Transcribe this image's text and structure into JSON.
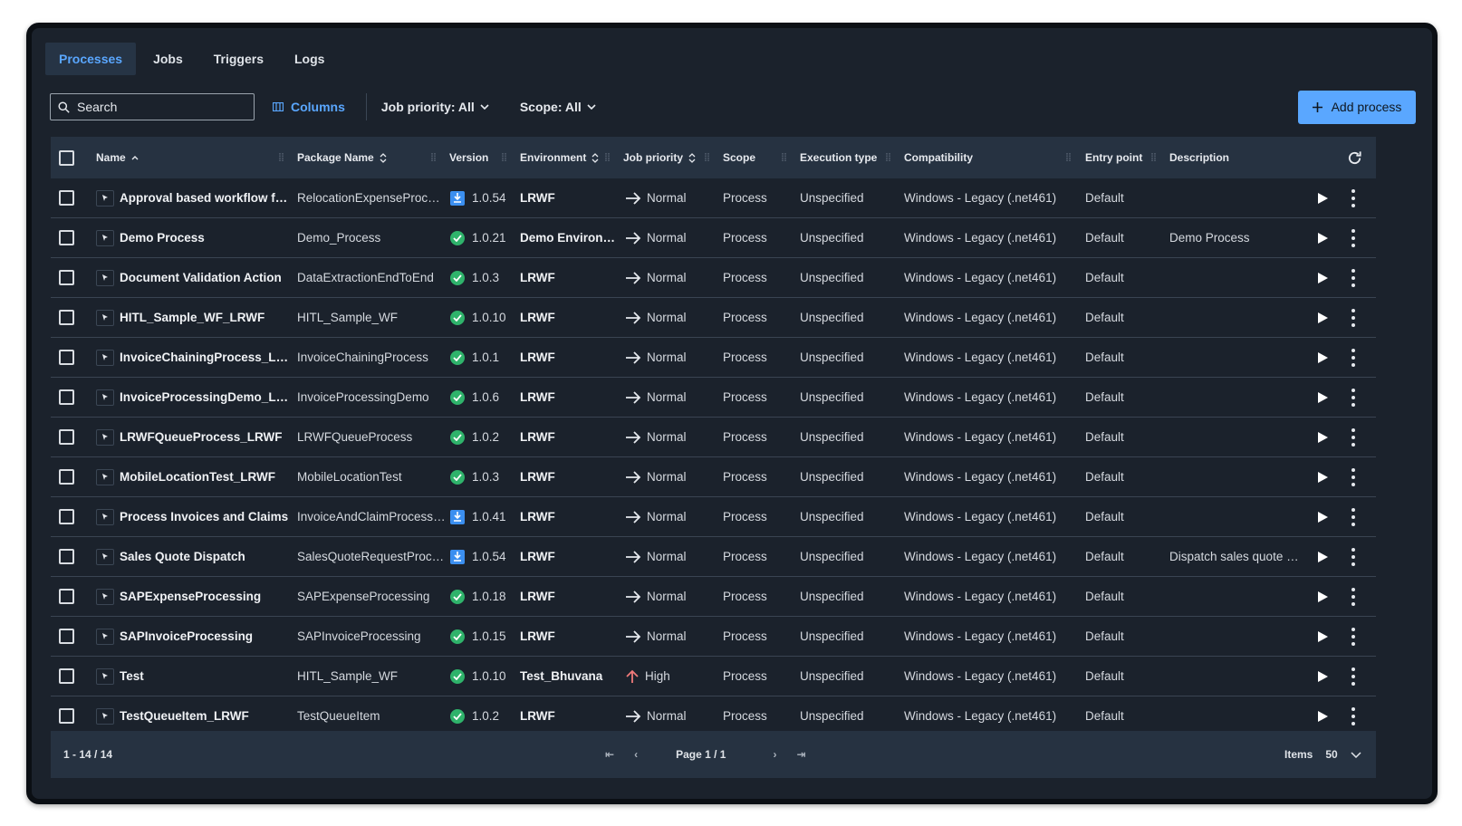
{
  "tabs": [
    {
      "label": "Processes",
      "active": true
    },
    {
      "label": "Jobs",
      "active": false
    },
    {
      "label": "Triggers",
      "active": false
    },
    {
      "label": "Logs",
      "active": false
    }
  ],
  "toolbar": {
    "search_placeholder": "Search",
    "columns_label": "Columns",
    "job_priority_filter": "Job priority: All",
    "scope_filter": "Scope: All",
    "add_process_label": "Add process"
  },
  "table": {
    "headers": {
      "name": "Name",
      "package": "Package Name",
      "version": "Version",
      "environment": "Environment",
      "job_priority": "Job priority",
      "scope": "Scope",
      "execution_type": "Execution type",
      "compatibility": "Compatibility",
      "entry_point": "Entry point",
      "description": "Description"
    },
    "rows": [
      {
        "name": "Approval based workflow for a...",
        "package": "RelocationExpenseProcess...",
        "version": "1.0.54",
        "version_status": "update",
        "environment": "LRWF",
        "priority": "Normal",
        "priority_icon": "arrow-right-icon",
        "scope": "Process",
        "execution_type": "Unspecified",
        "compatibility": "Windows - Legacy (.net461)",
        "entry_point": "Default",
        "description": ""
      },
      {
        "name": "Demo Process",
        "package": "Demo_Process",
        "version": "1.0.21",
        "version_status": "ok",
        "environment": "Demo Environm...",
        "priority": "Normal",
        "priority_icon": "arrow-right-icon",
        "scope": "Process",
        "execution_type": "Unspecified",
        "compatibility": "Windows - Legacy (.net461)",
        "entry_point": "Default",
        "description": "Demo Process"
      },
      {
        "name": "Document Validation Action",
        "package": "DataExtractionEndToEnd",
        "version": "1.0.3",
        "version_status": "ok",
        "environment": "LRWF",
        "priority": "Normal",
        "priority_icon": "arrow-right-icon",
        "scope": "Process",
        "execution_type": "Unspecified",
        "compatibility": "Windows - Legacy (.net461)",
        "entry_point": "Default",
        "description": ""
      },
      {
        "name": "HITL_Sample_WF_LRWF",
        "package": "HITL_Sample_WF",
        "version": "1.0.10",
        "version_status": "ok",
        "environment": "LRWF",
        "priority": "Normal",
        "priority_icon": "arrow-right-icon",
        "scope": "Process",
        "execution_type": "Unspecified",
        "compatibility": "Windows - Legacy (.net461)",
        "entry_point": "Default",
        "description": ""
      },
      {
        "name": "InvoiceChainingProcess_LRWF",
        "package": "InvoiceChainingProcess",
        "version": "1.0.1",
        "version_status": "ok",
        "environment": "LRWF",
        "priority": "Normal",
        "priority_icon": "arrow-right-icon",
        "scope": "Process",
        "execution_type": "Unspecified",
        "compatibility": "Windows - Legacy (.net461)",
        "entry_point": "Default",
        "description": ""
      },
      {
        "name": "InvoiceProcessingDemo_LRWF",
        "package": "InvoiceProcessingDemo",
        "version": "1.0.6",
        "version_status": "ok",
        "environment": "LRWF",
        "priority": "Normal",
        "priority_icon": "arrow-right-icon",
        "scope": "Process",
        "execution_type": "Unspecified",
        "compatibility": "Windows - Legacy (.net461)",
        "entry_point": "Default",
        "description": ""
      },
      {
        "name": "LRWFQueueProcess_LRWF",
        "package": "LRWFQueueProcess",
        "version": "1.0.2",
        "version_status": "ok",
        "environment": "LRWF",
        "priority": "Normal",
        "priority_icon": "arrow-right-icon",
        "scope": "Process",
        "execution_type": "Unspecified",
        "compatibility": "Windows - Legacy (.net461)",
        "entry_point": "Default",
        "description": ""
      },
      {
        "name": "MobileLocationTest_LRWF",
        "package": "MobileLocationTest",
        "version": "1.0.3",
        "version_status": "ok",
        "environment": "LRWF",
        "priority": "Normal",
        "priority_icon": "arrow-right-icon",
        "scope": "Process",
        "execution_type": "Unspecified",
        "compatibility": "Windows - Legacy (.net461)",
        "entry_point": "Default",
        "description": ""
      },
      {
        "name": "Process Invoices and Claims",
        "package": "InvoiceAndClaimProcessing",
        "version": "1.0.41",
        "version_status": "update",
        "environment": "LRWF",
        "priority": "Normal",
        "priority_icon": "arrow-right-icon",
        "scope": "Process",
        "execution_type": "Unspecified",
        "compatibility": "Windows - Legacy (.net461)",
        "entry_point": "Default",
        "description": ""
      },
      {
        "name": "Sales Quote Dispatch",
        "package": "SalesQuoteRequestProces...",
        "version": "1.0.54",
        "version_status": "update",
        "environment": "LRWF",
        "priority": "Normal",
        "priority_icon": "arrow-right-icon",
        "scope": "Process",
        "execution_type": "Unspecified",
        "compatibility": "Windows - Legacy (.net461)",
        "entry_point": "Default",
        "description": "Dispatch sales quote b..."
      },
      {
        "name": "SAPExpenseProcessing",
        "package": "SAPExpenseProcessing",
        "version": "1.0.18",
        "version_status": "ok",
        "environment": "LRWF",
        "priority": "Normal",
        "priority_icon": "arrow-right-icon",
        "scope": "Process",
        "execution_type": "Unspecified",
        "compatibility": "Windows - Legacy (.net461)",
        "entry_point": "Default",
        "description": ""
      },
      {
        "name": "SAPInvoiceProcessing",
        "package": "SAPInvoiceProcessing",
        "version": "1.0.15",
        "version_status": "ok",
        "environment": "LRWF",
        "priority": "Normal",
        "priority_icon": "arrow-right-icon",
        "scope": "Process",
        "execution_type": "Unspecified",
        "compatibility": "Windows - Legacy (.net461)",
        "entry_point": "Default",
        "description": ""
      },
      {
        "name": "Test",
        "package": "HITL_Sample_WF",
        "version": "1.0.10",
        "version_status": "ok",
        "environment": "Test_Bhuvana",
        "priority": "High",
        "priority_icon": "arrow-up-icon",
        "scope": "Process",
        "execution_type": "Unspecified",
        "compatibility": "Windows - Legacy (.net461)",
        "entry_point": "Default",
        "description": ""
      },
      {
        "name": "TestQueueItem_LRWF",
        "package": "TestQueueItem",
        "version": "1.0.2",
        "version_status": "ok",
        "environment": "LRWF",
        "priority": "Normal",
        "priority_icon": "arrow-right-icon",
        "scope": "Process",
        "execution_type": "Unspecified",
        "compatibility": "Windows - Legacy (.net461)",
        "entry_point": "Default",
        "description": ""
      }
    ]
  },
  "footer": {
    "range": "1 - 14 / 14",
    "page": "Page 1 / 1",
    "items_label": "Items",
    "items_per_page": "50"
  },
  "colors": {
    "accent": "#5aa7ff",
    "ok": "#2fb36b",
    "update": "#3b8ff0",
    "high_priority": "#f07a7a"
  }
}
